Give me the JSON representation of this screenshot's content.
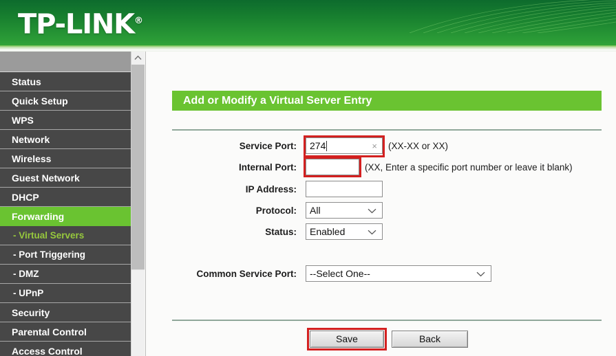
{
  "brand": {
    "name": "TP-LINK",
    "registered_mark": "®"
  },
  "sidebar": {
    "items": [
      {
        "label": "Status",
        "sub": false,
        "state": "normal"
      },
      {
        "label": "Quick Setup",
        "sub": false,
        "state": "normal"
      },
      {
        "label": "WPS",
        "sub": false,
        "state": "normal"
      },
      {
        "label": "Network",
        "sub": false,
        "state": "normal"
      },
      {
        "label": "Wireless",
        "sub": false,
        "state": "normal"
      },
      {
        "label": "Guest Network",
        "sub": false,
        "state": "normal"
      },
      {
        "label": "DHCP",
        "sub": false,
        "state": "normal"
      },
      {
        "label": "Forwarding",
        "sub": false,
        "state": "active-parent"
      },
      {
        "label": "- Virtual Servers",
        "sub": true,
        "state": "active-sub"
      },
      {
        "label": "- Port Triggering",
        "sub": true,
        "state": "normal"
      },
      {
        "label": "- DMZ",
        "sub": true,
        "state": "normal"
      },
      {
        "label": "- UPnP",
        "sub": true,
        "state": "normal"
      },
      {
        "label": "Security",
        "sub": false,
        "state": "normal"
      },
      {
        "label": "Parental Control",
        "sub": false,
        "state": "normal"
      },
      {
        "label": "Access Control",
        "sub": false,
        "state": "normal"
      }
    ]
  },
  "main": {
    "section_title": "Add or Modify a Virtual Server Entry",
    "fields": {
      "service_port": {
        "label": "Service Port:",
        "value": "274",
        "hint": "(XX-XX or XX)",
        "clear_icon": "×",
        "highlighted": true
      },
      "internal_port": {
        "label": "Internal Port:",
        "value": "",
        "hint": "(XX, Enter a specific port number or leave it blank)",
        "highlighted": true
      },
      "ip_address": {
        "label": "IP Address:",
        "value": ""
      },
      "protocol": {
        "label": "Protocol:",
        "value": "All"
      },
      "status": {
        "label": "Status:",
        "value": "Enabled"
      },
      "common_service_port": {
        "label": "Common Service Port:",
        "value": "--Select One--"
      }
    },
    "buttons": {
      "save": "Save",
      "back": "Back"
    }
  },
  "colors": {
    "brand_green": "#6ac331",
    "banner_green_dark": "#0d6b2d",
    "sidebar_dark": "#474747",
    "active_sub_text": "#97c93d",
    "annotation_red": "#d32020"
  }
}
